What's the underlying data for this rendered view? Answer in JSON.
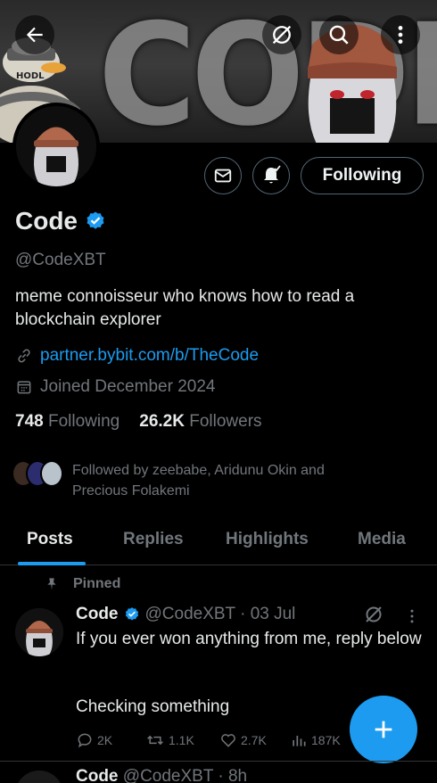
{
  "banner": {
    "text": "CODE",
    "badge_text": "HODL"
  },
  "header_icons": [
    "back-arrow-icon",
    "grok-icon",
    "search-icon",
    "more-vertical-icon"
  ],
  "profile": {
    "name": "Code",
    "handle": "@CodeXBT",
    "bio": "meme connoisseur who knows how to read a blockchain explorer",
    "link": "partner.bybit.com/b/TheCode",
    "joined": "Joined December 2024",
    "following_count": "748",
    "following_label": "Following",
    "followers_count": "26.2K",
    "followers_label": "Followers",
    "followed_by": "Followed by zeebabe, Aridunu Okin and Precious Folakemi",
    "verified_color": "#1d9bf0"
  },
  "actions": {
    "following_button": "Following"
  },
  "tabs": [
    {
      "label": "Posts",
      "active": true
    },
    {
      "label": "Replies",
      "active": false
    },
    {
      "label": "Highlights",
      "active": false
    },
    {
      "label": "Media",
      "active": false
    }
  ],
  "post": {
    "pinned_label": "Pinned",
    "author": "Code",
    "handle_time": "@CodeXBT · 03 Jul",
    "text": "If you ever won anything from me, reply below",
    "text2": "Checking something",
    "replies": "2K",
    "reposts": "1.1K",
    "likes": "2.7K",
    "views": "187K"
  },
  "next_post": {
    "author": "Code",
    "handle_time": "@CodeXBT · 8h"
  },
  "colors": {
    "accent": "#1d9bf0",
    "background": "#000000",
    "muted": "#71767b",
    "text": "#e7e9ea"
  }
}
